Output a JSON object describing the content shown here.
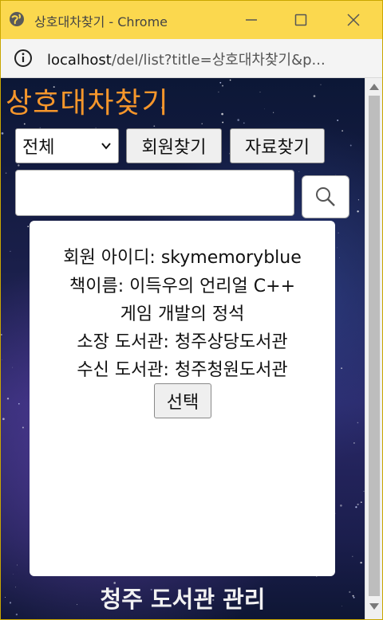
{
  "window": {
    "title": "상호대차찾기 - Chrome",
    "url_host": "localhost",
    "url_path": "/del/list?title=상호대차찾기&p..."
  },
  "page": {
    "brand_title": "상호대차찾기",
    "filter_select_value": "전체",
    "member_search_label": "회원찾기",
    "data_search_label": "자료찾기",
    "search_placeholder": "",
    "footer_title": "청주 도서관 관리"
  },
  "result_card": {
    "member_id_line": "회원 아이디: skymemoryblue",
    "book_name_line1": "책이름: 이득우의 언리얼 C++",
    "book_name_line2": "게임 개발의 정석",
    "holding_library_line": "소장 도서관: 청주상당도서관",
    "receiving_library_line": "수신 도서관: 청주청원도서관",
    "select_label": "선택"
  },
  "icons": {
    "globe": "globe-icon",
    "minimize": "minimize-icon",
    "maximize": "maximize-icon",
    "close": "close-icon",
    "info": "info-icon",
    "search": "search-icon",
    "chevron": "chevron-down-icon"
  },
  "colors": {
    "titlebar": "#fbd84e",
    "brand": "#f6962b",
    "footer_text": "#f2f2f2"
  }
}
